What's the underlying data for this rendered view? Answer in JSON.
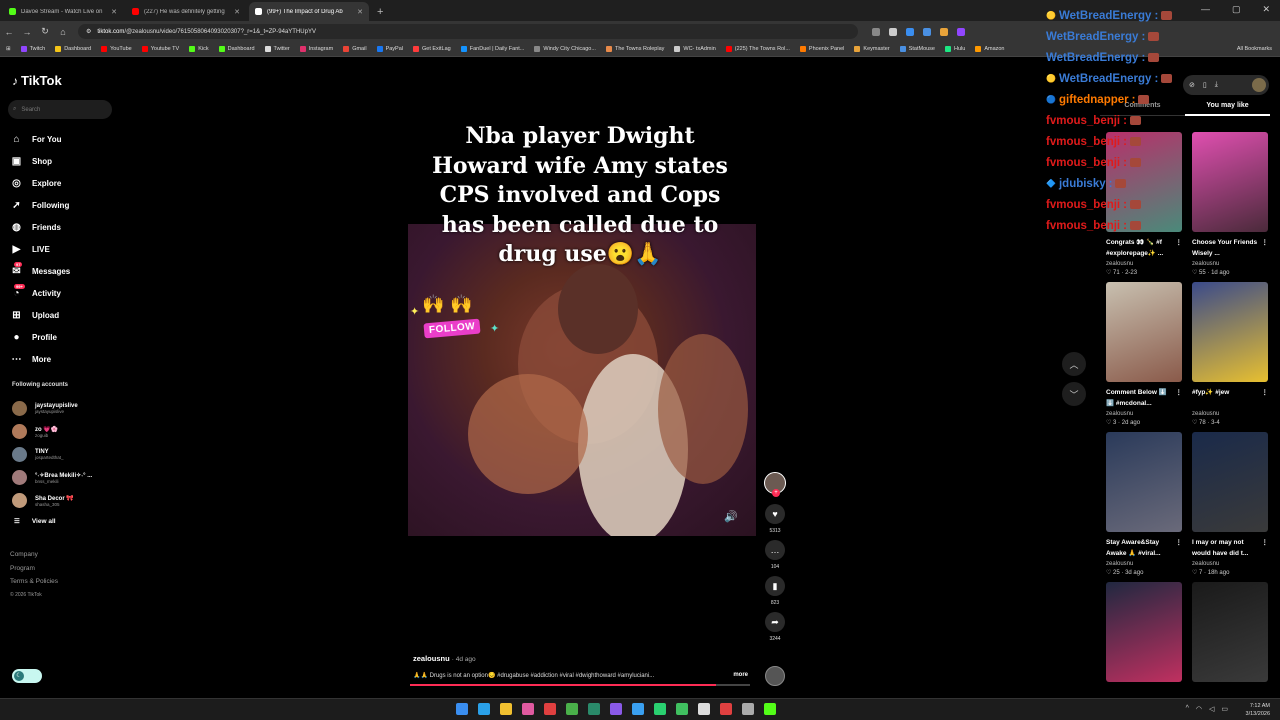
{
  "browser": {
    "tabs": [
      {
        "title": "Davoe Stream - Watch Live on",
        "color": "#53fc18",
        "active": false
      },
      {
        "title": "(227) He was definitely getting",
        "color": "#ff0000",
        "active": false
      },
      {
        "title": "(99+) The Impact of Drug Ab",
        "color": "#ffffff",
        "active": true
      }
    ],
    "url_site": "tiktok.com",
    "url_path": "/@zealousnu/video/7615058064093020307?_r=1&_t=ZP-94aYTHUpYV",
    "bookmarks": [
      {
        "label": "Twitch",
        "color": "#9146ff"
      },
      {
        "label": "Dashboard",
        "color": "#f5c518"
      },
      {
        "label": "YouTube",
        "color": "#ff0000"
      },
      {
        "label": "Youtube TV",
        "color": "#ff0000"
      },
      {
        "label": "Kick",
        "color": "#53fc18"
      },
      {
        "label": "Dashboard",
        "color": "#53fc18"
      },
      {
        "label": "Twitter",
        "color": "#dddddd"
      },
      {
        "label": "Instagram",
        "color": "#e1306c"
      },
      {
        "label": "Gmail",
        "color": "#ea4335"
      },
      {
        "label": "PayPal",
        "color": "#1877f2"
      },
      {
        "label": "Get ExitLag",
        "color": "#ff3b3b"
      },
      {
        "label": "FanDuel | Daily Fant...",
        "color": "#1493ff"
      },
      {
        "label": "Windy City Chicago...",
        "color": "#888888"
      },
      {
        "label": "The Towns Roleplay",
        "color": "#e88a4a"
      },
      {
        "label": "WC- txAdmin",
        "color": "#cccccc"
      },
      {
        "label": "(225) The Towns Rol...",
        "color": "#ff0000"
      },
      {
        "label": "Phoenix Panel",
        "color": "#ff7a00"
      },
      {
        "label": "Keymaster",
        "color": "#e8a33a"
      },
      {
        "label": "StatMouse",
        "color": "#4a90e2"
      },
      {
        "label": "Hulu",
        "color": "#1ce783"
      },
      {
        "label": "Amazon",
        "color": "#ff9900"
      }
    ],
    "all_bookmarks": "All Bookmarks"
  },
  "sidebar": {
    "logo": "TikTok",
    "search_placeholder": "Search",
    "nav": [
      {
        "label": "For You",
        "icon": "⌂",
        "name": "home-icon"
      },
      {
        "label": "Shop",
        "icon": "▣",
        "name": "shop-icon"
      },
      {
        "label": "Explore",
        "icon": "◎",
        "name": "compass-icon"
      },
      {
        "label": "Following",
        "icon": "➚",
        "name": "following-icon"
      },
      {
        "label": "Friends",
        "icon": "◍",
        "name": "friends-icon"
      },
      {
        "label": "LIVE",
        "icon": "▶",
        "name": "live-icon"
      },
      {
        "label": "Messages",
        "icon": "✉",
        "name": "messages-icon",
        "badge": "97"
      },
      {
        "label": "Activity",
        "icon": "◔",
        "name": "activity-icon",
        "badge": "99+"
      },
      {
        "label": "Upload",
        "icon": "⊞",
        "name": "upload-icon"
      },
      {
        "label": "Profile",
        "icon": "●",
        "name": "profile-icon"
      },
      {
        "label": "More",
        "icon": "⋯",
        "name": "more-icon"
      }
    ],
    "following_title": "Following accounts",
    "following": [
      {
        "name": "jaystayupislive",
        "handle": "jaystayupislive",
        "color": "#8a6a4a"
      },
      {
        "name": "zo 💗🌸",
        "handle": "zoguib",
        "color": "#b07a5a"
      },
      {
        "name": "TINY",
        "handle": "jospartedthat_",
        "color": "#6a7a8a"
      },
      {
        "name": "°˖✧Brea Mekili✧˖° ...",
        "handle": "bnss_mekili",
        "color": "#a07a7a"
      },
      {
        "name": "Sha Decor 🎀",
        "handle": "shasha_305",
        "color": "#c09a7a"
      }
    ],
    "view_all": "View all",
    "footer": [
      "Company",
      "Program",
      "Terms & Policies"
    ],
    "copyright": "© 2026 TikTok"
  },
  "video": {
    "caption": "Nba player Dwight Howard wife Amy states CPS involved and Cops has been called due to drug use😮🙏",
    "follow_badge": "FOLLOW",
    "likes": "5313",
    "comments": "104",
    "saves": "823",
    "shares": "3244",
    "author": "zealousnu",
    "posted": "4d ago",
    "description": "🙏🙏 Drugs is not an option😔 #drugabuse #addiction #viral #dwighthoward #amyluciani...",
    "more": "more",
    "progress": 0.9
  },
  "panel": {
    "tab_comments": "Comments",
    "tab_you_may_like": "You may like",
    "cards": [
      {
        "title": "Congrats 👀 🍾 #f #explorepage✨ ...",
        "user": "zealousnu",
        "likes": "71",
        "date": "2-23",
        "c1": "#b8306a",
        "c2": "#4a8a7a"
      },
      {
        "title": "Choose Your Friends Wisely ...",
        "user": "zealousnu",
        "likes": "55",
        "date": "1d ago",
        "c1": "#e04fb0",
        "c2": "#4a2a3a"
      },
      {
        "title": "Comment Below ⬇️ ⬇️ #mcdonal...",
        "user": "zealousnu",
        "likes": "3",
        "date": "2d ago",
        "c1": "#c8c0b0",
        "c2": "#8a5a4a"
      },
      {
        "title": "#fyp✨ #jew",
        "user": "zealousnu",
        "likes": "78",
        "date": "3-4",
        "c1": "#3a4a8a",
        "c2": "#e8c030"
      },
      {
        "title": "Stay Aware&Stay Awake 🙏 #viral...",
        "user": "zealousnu",
        "likes": "25",
        "date": "3d ago",
        "c1": "#2a3a5a",
        "c2": "#6a6a7a"
      },
      {
        "title": "I may or may not would have did t...",
        "user": "zealousnu",
        "likes": "7",
        "date": "18h ago",
        "c1": "#1a2a4a",
        "c2": "#3a3a3a"
      },
      {
        "title": "",
        "user": "",
        "likes": "",
        "date": "",
        "c1": "#202840",
        "c2": "#c03060"
      },
      {
        "title": "",
        "user": "",
        "likes": "",
        "date": "",
        "c1": "#1a1a1a",
        "c2": "#3a3a3a"
      }
    ]
  },
  "chat": [
    {
      "user": "WetBreadEnergy",
      "color": "#3a7bd5",
      "icon": "🟡"
    },
    {
      "user": "WetBreadEnergy",
      "color": "#3a7bd5",
      "icon": ""
    },
    {
      "user": "WetBreadEnergy",
      "color": "#3a7bd5",
      "icon": ""
    },
    {
      "user": "WetBreadEnergy",
      "color": "#3a7bd5",
      "icon": "🟡"
    },
    {
      "user": "giftednapper",
      "color": "#ff7a00",
      "icon": "🔵"
    },
    {
      "user": "fvmous_benji",
      "color": "#e01b1b",
      "icon": ""
    },
    {
      "user": "fvmous_benji",
      "color": "#e01b1b",
      "icon": ""
    },
    {
      "user": "fvmous_benji",
      "color": "#e01b1b",
      "icon": ""
    },
    {
      "user": "jdubisky",
      "color": "#3a7bd5",
      "icon": "🔷"
    },
    {
      "user": "fvmous_benji",
      "color": "#e01b1b",
      "icon": ""
    },
    {
      "user": "fvmous_benji",
      "color": "#e01b1b",
      "icon": ""
    }
  ],
  "taskbar": {
    "time": "7:12 AM",
    "date": "3/13/2026",
    "apps": [
      "#3a8ef0",
      "#2aa0e8",
      "#f0c030",
      "#e05aa0",
      "#e04040",
      "#4ab04a",
      "#2a8a6a",
      "#8a5ae8",
      "#3aa0f0",
      "#2ad070",
      "#40c060",
      "#dddddd",
      "#e04040",
      "#aaaaaa",
      "#53fc18"
    ]
  }
}
